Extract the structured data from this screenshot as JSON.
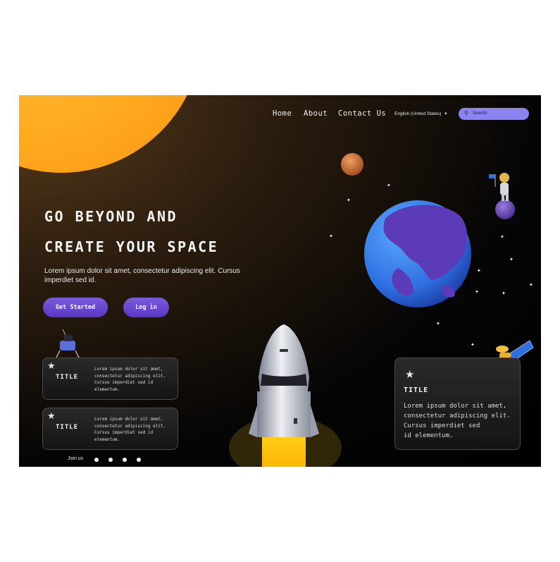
{
  "nav": {
    "home": "Home",
    "about": "About",
    "contact": "Contact Us"
  },
  "language": "English (United States)",
  "search": {
    "placeholder": "Search"
  },
  "hero": {
    "line1": "GO BEYOND AND",
    "line2": "CREATE YOUR SPACE",
    "lede": "Lorem ipsum dolor sit amet, consectetur adipiscing elit. Cursus imperdiet sed id.",
    "get_started": "Get Started",
    "login": "Log in"
  },
  "cards": [
    {
      "title": "TITLE",
      "body": "Lorem ipsum dolor sit amet,\nconsectetur adipiscing elit.\nCursus imperdiet sed id\nelementum."
    },
    {
      "title": "TITLE",
      "body": "Lorem ipsum dolor sit amet,\nconsectetur adipiscing elit.\nCursus imperdiet sed id\nelementum."
    },
    {
      "title": "TITLE",
      "body": "Lorem ipsum dolor sit amet,\nconsectetur adipiscing elit. Cursus imperdiet sed\nid elementum."
    }
  ],
  "footer": {
    "join": "Join us"
  },
  "icons": [
    "star-icon",
    "search-icon",
    "chevron-down-icon",
    "facebook-icon",
    "twitter-icon",
    "instagram-icon",
    "youtube-icon"
  ],
  "colors": {
    "accent": "#7a5bdc",
    "sun": "#ffaa1f",
    "search": "#8a84f0",
    "earth_ocean": "#2f7fe6",
    "earth_land": "#6a3fbf"
  }
}
